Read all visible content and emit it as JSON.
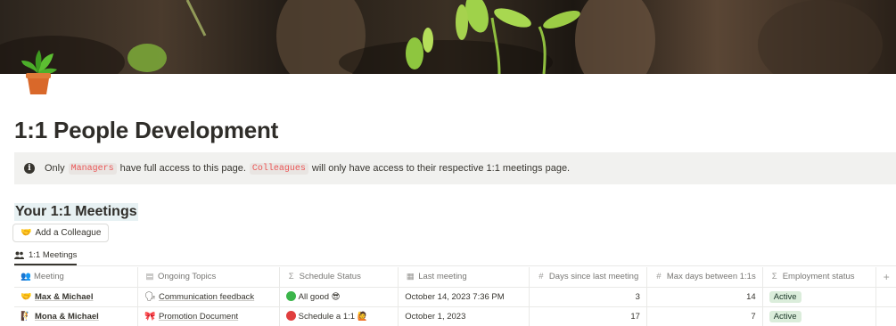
{
  "page": {
    "title": "1:1 People Development",
    "icon": "potted-plant-icon"
  },
  "callout": {
    "icon": "info-icon",
    "text_1": "Only",
    "code_1": "Managers",
    "text_2": "have full access to this page.",
    "code_2": "Colleagues",
    "text_3": "will only have access to their respective 1:1 meetings page."
  },
  "section": {
    "heading": "Your 1:1 Meetings",
    "add_button_icon": "handshake-icon",
    "add_button_label": "Add a Colleague"
  },
  "view_tab": {
    "icon": "people-icon",
    "label": "1:1 Meetings"
  },
  "table": {
    "columns": [
      {
        "label": "Meeting",
        "icon": "people-icon"
      },
      {
        "label": "Ongoing Topics",
        "icon": "document-icon"
      },
      {
        "label": "Schedule Status",
        "icon": "formula-icon"
      },
      {
        "label": "Last meeting",
        "icon": "calendar-icon"
      },
      {
        "label": "Days since last meeting",
        "icon": "hash-icon"
      },
      {
        "label": "Max days between 1:1s",
        "icon": "hash-icon"
      },
      {
        "label": "Employment status",
        "icon": "select-icon"
      }
    ],
    "add_column_symbol": "+",
    "rows": [
      {
        "meeting": "Max & Michael",
        "meeting_icon": "handshake-icon",
        "topic": "Communication feedback",
        "topic_icon": "speaking-head-icon",
        "status": "All good 😎",
        "status_color": "#3bb54a",
        "last_meeting": "October 14, 2023 7:36 PM",
        "days_since": "3",
        "max_days": "14",
        "employment": "Active"
      },
      {
        "meeting": "Mona & Michael",
        "meeting_icon": "climber-icon",
        "topic": "Promotion Document",
        "topic_icon": "ribbon-icon",
        "status": "Schedule a 1:1 🙋",
        "status_color": "#e03e3e",
        "last_meeting": "October 1, 2023",
        "days_since": "17",
        "max_days": "7",
        "employment": "Active"
      }
    ]
  }
}
